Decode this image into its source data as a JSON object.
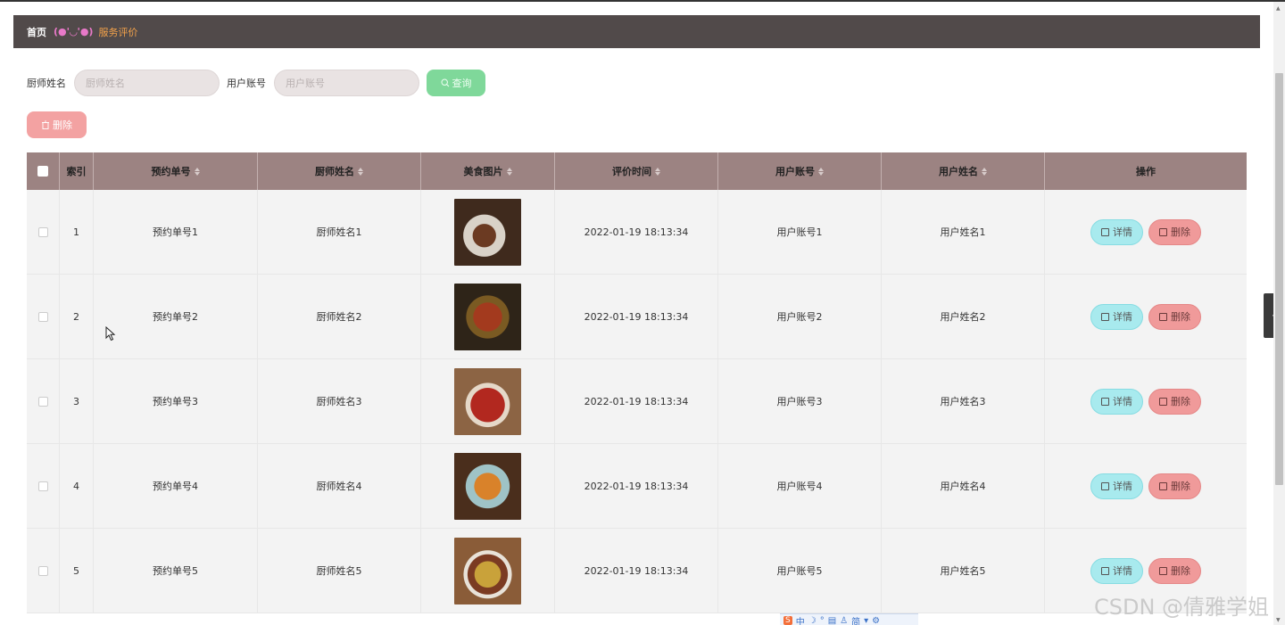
{
  "breadcrumb": {
    "home": "首页",
    "emoticon": "(●'◡'●)",
    "current": "服务评价"
  },
  "search": {
    "chef_label": "厨师姓名",
    "chef_placeholder": "厨师姓名",
    "user_label": "用户账号",
    "user_placeholder": "用户账号",
    "query_label": "查询"
  },
  "toolbar": {
    "delete_label": "删除"
  },
  "table": {
    "headers": [
      "索引",
      "预约单号",
      "厨师姓名",
      "美食图片",
      "评价时间",
      "用户账号",
      "用户姓名",
      "操作"
    ],
    "rows": [
      {
        "index": "1",
        "order": "预约单号1",
        "chef": "厨师姓名1",
        "time": "2022-01-19 18:13:34",
        "account": "用户账号1",
        "name": "用户姓名1"
      },
      {
        "index": "2",
        "order": "预约单号2",
        "chef": "厨师姓名2",
        "time": "2022-01-19 18:13:34",
        "account": "用户账号2",
        "name": "用户姓名2"
      },
      {
        "index": "3",
        "order": "预约单号3",
        "chef": "厨师姓名3",
        "time": "2022-01-19 18:13:34",
        "account": "用户账号3",
        "name": "用户姓名3"
      },
      {
        "index": "4",
        "order": "预约单号4",
        "chef": "厨师姓名4",
        "time": "2022-01-19 18:13:34",
        "account": "用户账号4",
        "name": "用户姓名4"
      },
      {
        "index": "5",
        "order": "预约单号5",
        "chef": "厨师姓名5",
        "time": "2022-01-19 18:13:34",
        "account": "用户账号5",
        "name": "用户姓名5"
      }
    ],
    "detail_label": "详情",
    "delete_label": "删除"
  },
  "ime": {
    "chars": [
      "中",
      "简"
    ]
  },
  "watermark": "CSDN @倩雅学姐",
  "colors": {
    "topbar": "#514a4a",
    "header": "#9c8382",
    "query": "#7fd89a",
    "delete": "#f09a9a",
    "detail": "#a8eaee"
  }
}
